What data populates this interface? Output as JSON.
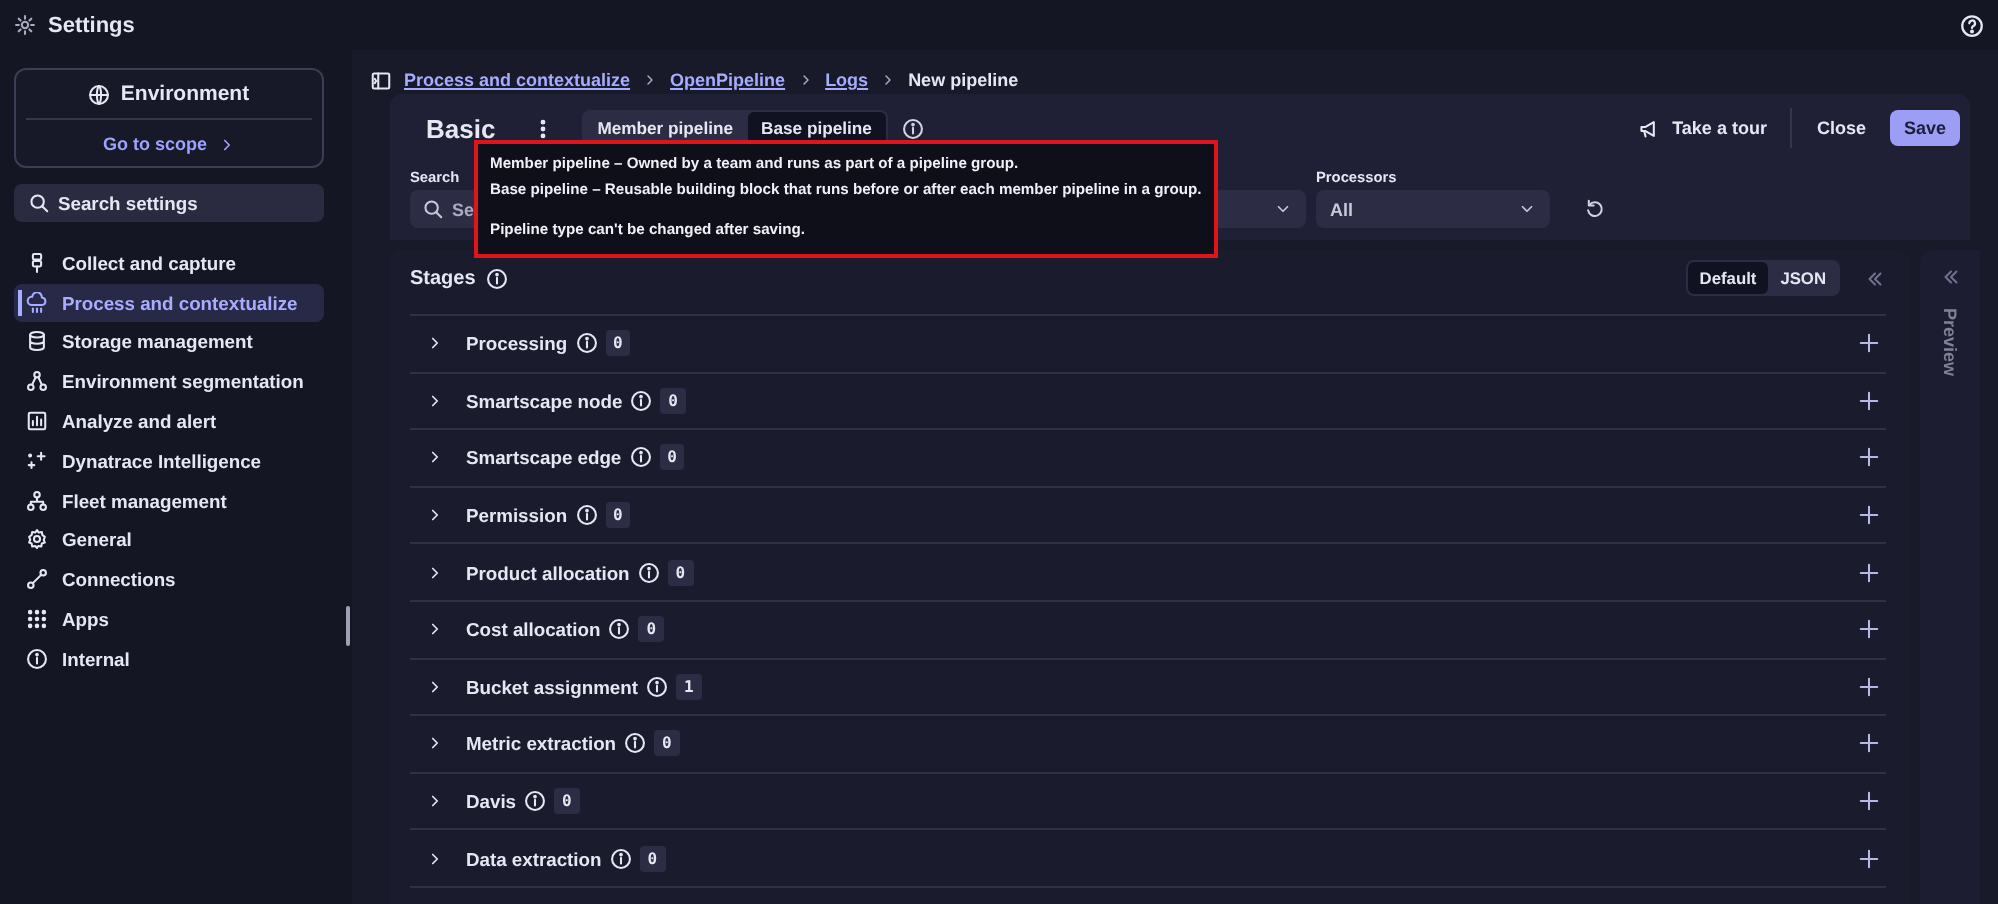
{
  "window": {
    "title": "Settings"
  },
  "sidebar": {
    "scope": {
      "title": "Environment",
      "link": "Go to scope"
    },
    "search": {
      "placeholder": "Search settings"
    },
    "items": [
      {
        "label": "Collect and capture",
        "selected": false
      },
      {
        "label": "Process and contextualize",
        "selected": true
      },
      {
        "label": "Storage management",
        "selected": false
      },
      {
        "label": "Environment segmentation",
        "selected": false
      },
      {
        "label": "Analyze and alert",
        "selected": false
      },
      {
        "label": "Dynatrace Intelligence",
        "selected": false
      },
      {
        "label": "Fleet management",
        "selected": false
      },
      {
        "label": "General",
        "selected": false
      },
      {
        "label": "Connections",
        "selected": false
      },
      {
        "label": "Apps",
        "selected": false
      },
      {
        "label": "Internal",
        "selected": false
      }
    ]
  },
  "breadcrumbs": [
    {
      "label": "Process and contextualize",
      "link": true
    },
    {
      "label": "OpenPipeline",
      "link": true
    },
    {
      "label": "Logs",
      "link": true
    },
    {
      "label": "New pipeline",
      "link": false
    }
  ],
  "header": {
    "title": "Basic",
    "type_tabs": [
      {
        "label": "Member pipeline",
        "selected": false
      },
      {
        "label": "Base pipeline",
        "selected": true
      }
    ],
    "tour": "Take a tour",
    "close": "Close",
    "save": "Save"
  },
  "filters": {
    "search": {
      "label": "Search",
      "placeholder": "Se"
    },
    "processors": {
      "label": "Processors",
      "value": "All"
    }
  },
  "tooltip": {
    "lines": [
      "Member pipeline – Owned by a team and runs as part of a pipeline group.",
      "Base pipeline – Reusable building block that runs before or after each member pipeline in a group."
    ],
    "note": "Pipeline type can't be changed after saving."
  },
  "stages": {
    "title": "Stages",
    "view_toggle": [
      {
        "label": "Default",
        "selected": true
      },
      {
        "label": "JSON",
        "selected": false
      }
    ],
    "rows": [
      {
        "label": "Processing",
        "count": "0"
      },
      {
        "label": "Smartscape node",
        "count": "0"
      },
      {
        "label": "Smartscape edge",
        "count": "0"
      },
      {
        "label": "Permission",
        "count": "0"
      },
      {
        "label": "Product allocation",
        "count": "0"
      },
      {
        "label": "Cost allocation",
        "count": "0"
      },
      {
        "label": "Bucket assignment",
        "count": "1"
      },
      {
        "label": "Metric extraction",
        "count": "0"
      },
      {
        "label": "Davis",
        "count": "0"
      },
      {
        "label": "Data extraction",
        "count": "0"
      }
    ]
  },
  "preview": {
    "label": "Preview"
  }
}
